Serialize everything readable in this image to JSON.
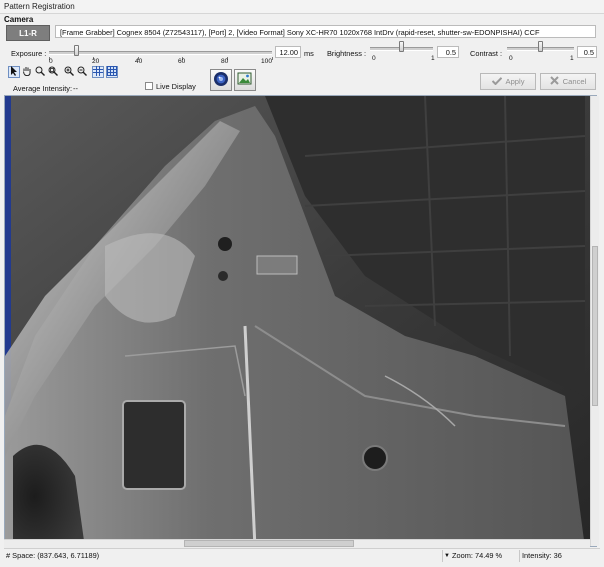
{
  "window": {
    "title": "Pattern Registration"
  },
  "camera": {
    "section_label": "Camera",
    "id_label": "L1-R",
    "info_text": "[Frame Grabber] Cognex 8504 (Z72543117),    [Port] 2,    [Video Format] Sony XC-HR70 1020x768 IntDrv (rapid-reset, shutter-sw-EDONPISHAI) CCF"
  },
  "exposure": {
    "label": "Exposure :",
    "value": "12.00",
    "unit": "ms",
    "slider_fraction": 0.15,
    "ticks": [
      "0",
      "20",
      "40",
      "60",
      "80",
      "100"
    ]
  },
  "brightness": {
    "label": "Brightness :",
    "min": "0",
    "max": "1",
    "value": "0.5",
    "slider_fraction": 0.5
  },
  "contrast": {
    "label": "Contrast :",
    "min": "0",
    "max": "1",
    "value": "0.5",
    "slider_fraction": 0.5
  },
  "toolbar": {
    "live_display_label": "Live Display",
    "live_display_checked": false,
    "apply_label": "Apply",
    "cancel_label": "Cancel",
    "average_intensity_label": "Average Intensity:",
    "average_intensity_value": "--"
  },
  "status": {
    "space_text": "# Space: (837.643, 6.71189)",
    "zoom_text": "Zoom: 74.49 %",
    "intensity_text": "Intensity: 36"
  },
  "colors": {
    "accent": "#6f8fc2",
    "disabled_text": "#8f8f8f",
    "viewport_border": "#9aa9bb"
  }
}
